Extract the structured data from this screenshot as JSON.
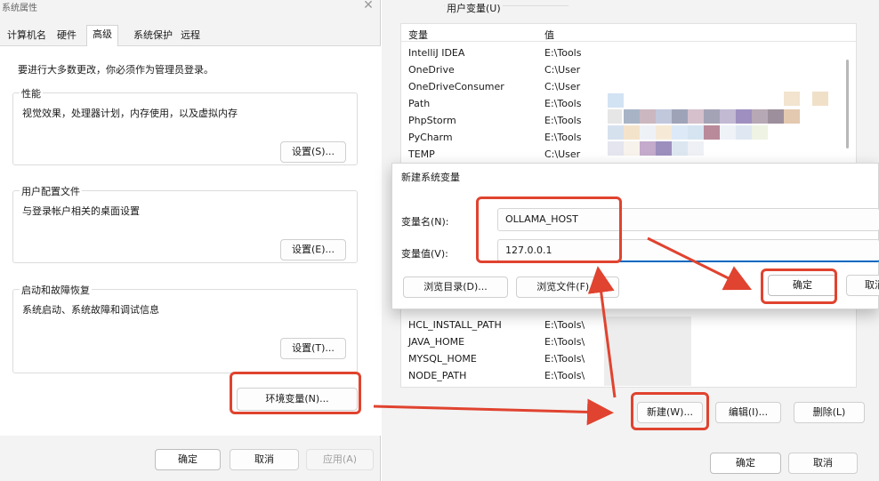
{
  "system_properties": {
    "window_title": "系统属性",
    "tabs": [
      "计算机名",
      "硬件",
      "高级",
      "系统保护",
      "远程"
    ],
    "active_tab": "高级",
    "admin_notice": "要进行大多数更改，你必须作为管理员登录。",
    "performance": {
      "title": "性能",
      "description": "视觉效果，处理器计划，内存使用，以及虚拟内存",
      "button": "设置(S)..."
    },
    "user_profiles": {
      "title": "用户配置文件",
      "description": "与登录帐户相关的桌面设置",
      "button": "设置(E)..."
    },
    "startup_recovery": {
      "title": "启动和故障恢复",
      "description": "系统启动、系统故障和调试信息",
      "button": "设置(T)..."
    },
    "env_button": "环境变量(N)...",
    "ok": "确定",
    "cancel": "取消",
    "apply": "应用(A)"
  },
  "environment_variables": {
    "user_vars_title": "用户变量(U)",
    "columns": {
      "name": "变量",
      "value": "值"
    },
    "user_vars": [
      {
        "name": "IntelliJ IDEA",
        "value": "E:\\Tools"
      },
      {
        "name": "OneDrive",
        "value": "C:\\User"
      },
      {
        "name": "OneDriveConsumer",
        "value": "C:\\User"
      },
      {
        "name": "Path",
        "value": "E:\\Tools"
      },
      {
        "name": "PhpStorm",
        "value": "E:\\Tools"
      },
      {
        "name": "PyCharm",
        "value": "E:\\Tools"
      },
      {
        "name": "TEMP",
        "value": "C:\\User"
      }
    ],
    "system_vars": [
      {
        "name": "HCL_INSTALL_PATH",
        "value": "E:\\Tools\\"
      },
      {
        "name": "JAVA_HOME",
        "value": "E:\\Tools\\"
      },
      {
        "name": "MYSQL_HOME",
        "value": "E:\\Tools\\"
      },
      {
        "name": "NODE_PATH",
        "value": "E:\\Tools\\"
      }
    ],
    "new_button": "新建(W)...",
    "edit_button": "编辑(I)...",
    "delete_button": "删除(L)",
    "ok": "确定",
    "cancel": "取消"
  },
  "new_system_variable": {
    "title": "新建系统变量",
    "name_label": "变量名(N):",
    "name_value": "OLLAMA_HOST",
    "value_label": "变量值(V):",
    "value_value": "127.0.0.1",
    "browse_dir": "浏览目录(D)...",
    "browse_file": "浏览文件(F)...",
    "ok": "确定",
    "cancel": "取消"
  },
  "colors": {
    "highlight": "#e0432f",
    "accent": "#0067c0"
  }
}
